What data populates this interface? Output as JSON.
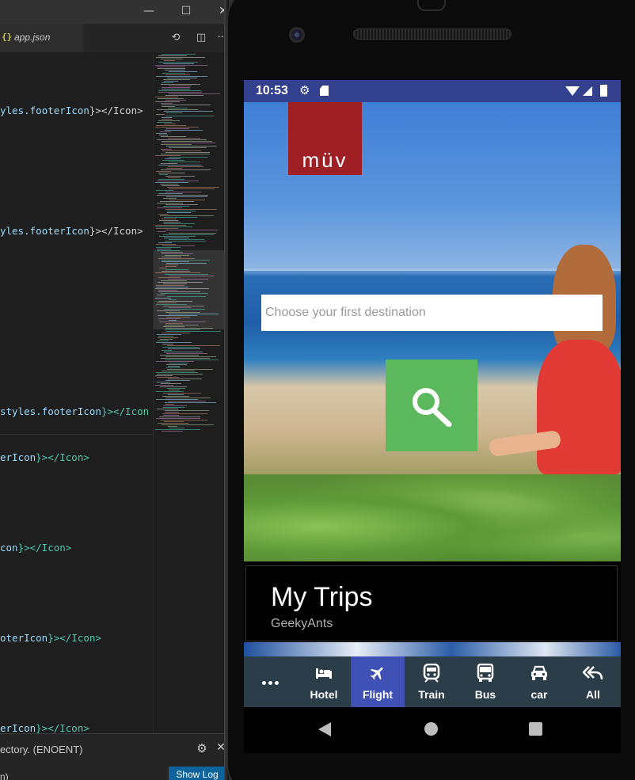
{
  "editor": {
    "tab": {
      "braces": "{}",
      "label": "app.json"
    },
    "window_controls": {
      "minimize": "—",
      "maximize": "☐",
      "close": "✕"
    },
    "tab_actions": {
      "compare": "⟲",
      "split": "◫",
      "more": "···"
    },
    "code_lines": [
      {
        "pre": "yles.",
        "mid": "footerIcon",
        "post": "}></Icon>"
      },
      {
        "pre": "yles.",
        "mid": "footerIcon",
        "post": "}></Icon>"
      },
      {
        "pre": "styles.",
        "mid": "footerIcon",
        "post": "}></Icon"
      },
      {
        "pre": "",
        "mid": "erIcon",
        "post": "}></Icon>"
      },
      {
        "pre": "",
        "mid": "con",
        "post": "}></Icon>"
      },
      {
        "pre": "",
        "mid": "oterIcon",
        "post": "}></Icon>"
      },
      {
        "pre": "",
        "mid": "erIcon",
        "post": "}></Icon>"
      }
    ],
    "panel": {
      "message": "ectory. (ENOENT)",
      "message2": "n)",
      "show_log": "Show Log"
    }
  },
  "phone": {
    "status": {
      "time": "10:53"
    },
    "logo": "müv",
    "search": {
      "placeholder": "Choose your first destination"
    },
    "trips": {
      "title": "My Trips",
      "subtitle": "GeekyAnts"
    },
    "footer": {
      "more": "...",
      "tabs": [
        {
          "label": "Hotel",
          "icon": "bed-icon",
          "active": false
        },
        {
          "label": "Flight",
          "icon": "plane-icon",
          "active": true
        },
        {
          "label": "Train",
          "icon": "train-icon",
          "active": false
        },
        {
          "label": "Bus",
          "icon": "bus-icon",
          "active": false
        },
        {
          "label": "car",
          "icon": "car-icon",
          "active": false
        },
        {
          "label": "All",
          "icon": "reply-all-icon",
          "active": false
        }
      ]
    },
    "colors": {
      "status_bar": "#33408e",
      "footer": "#2b3d48",
      "footer_active": "#3f51b5",
      "logo": "#9e1f24",
      "search_button": "#5cb85c"
    }
  }
}
